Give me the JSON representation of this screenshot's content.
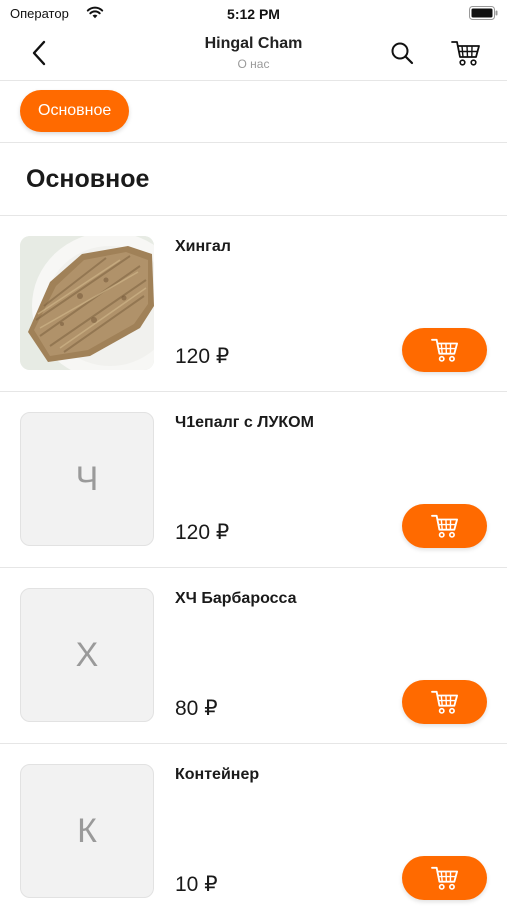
{
  "status_bar": {
    "carrier": "Оператор",
    "time": "5:12 PM"
  },
  "nav": {
    "title": "Hingal Cham",
    "subtitle": "О нас"
  },
  "categories": [
    {
      "label": "Основное",
      "selected": true
    }
  ],
  "section": {
    "title": "Основное"
  },
  "products": [
    {
      "name": "Хингал",
      "price": "120 ₽",
      "thumb_letter": "",
      "has_photo": true
    },
    {
      "name": "Ч1епалг с ЛУКОМ",
      "price": "120 ₽",
      "thumb_letter": "Ч",
      "has_photo": false
    },
    {
      "name": "ХЧ Барбаросса",
      "price": "80 ₽",
      "thumb_letter": "Х",
      "has_photo": false
    },
    {
      "name": "Контейнер",
      "price": "10 ₽",
      "thumb_letter": "К",
      "has_photo": false
    }
  ],
  "colors": {
    "accent": "#ff6a00",
    "placeholder_bg": "#f2f2f2",
    "divider": "#e6e6e6"
  },
  "icons": {
    "back": "chevron-left-icon",
    "search": "search-icon",
    "cart": "cart-icon",
    "wifi": "wifi-icon",
    "battery": "battery-icon"
  }
}
